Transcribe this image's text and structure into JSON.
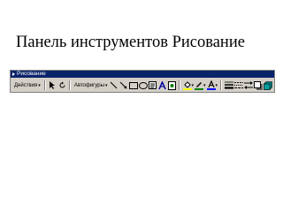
{
  "slide": {
    "title": "Панель инструментов Рисование"
  },
  "toolbar": {
    "title": "Рисование",
    "actions_menu": "Действия",
    "autoshapes_menu": "Автофигуры",
    "buttons": [
      "select-objects",
      "free-rotate",
      "line",
      "arrow",
      "rectangle",
      "oval",
      "text-box",
      "wordart",
      "clip-art",
      "fill-color",
      "line-color",
      "font-color",
      "line-style",
      "dash-style",
      "arrow-style",
      "shadow",
      "3d"
    ]
  },
  "colors": {
    "toolbar_bg": "#d4d0c8",
    "titlebar_bg": "#0a246a",
    "fill_color": "#ffff00",
    "line_color": "#008000",
    "font_color": "#0000ff"
  }
}
